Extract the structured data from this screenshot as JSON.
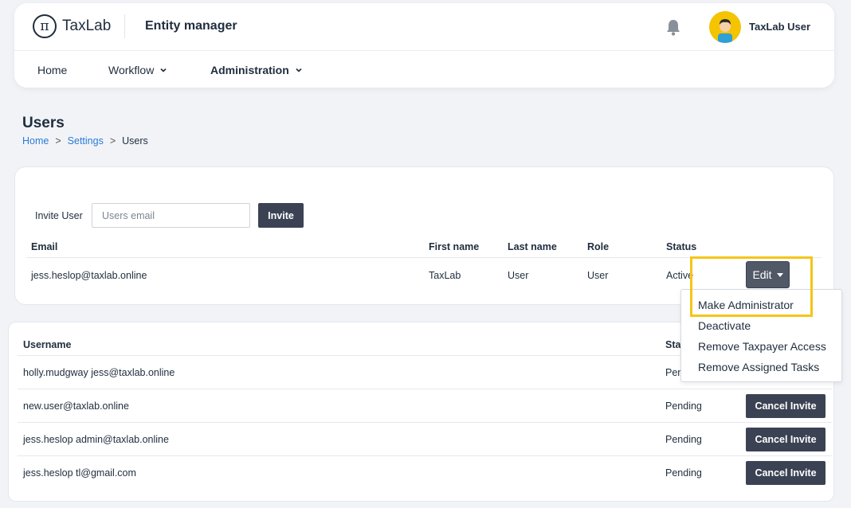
{
  "header": {
    "logo_symbol": "π",
    "logo_text": "TaxLab",
    "app_title": "Entity manager",
    "user_name": "TaxLab User",
    "nav": [
      {
        "label": "Home"
      },
      {
        "label": "Workflow"
      },
      {
        "label": "Administration"
      }
    ]
  },
  "page": {
    "title": "Users",
    "breadcrumb": [
      "Home",
      "Settings",
      "Users"
    ],
    "breadcrumb_sep": ">"
  },
  "invite": {
    "label": "Invite User",
    "placeholder": "Users email",
    "button": "Invite"
  },
  "users_table": {
    "headers": [
      "Email",
      "First name",
      "Last name",
      "Role",
      "Status"
    ],
    "rows": [
      {
        "email": "jess.heslop@taxlab.online",
        "first_name": "TaxLab",
        "last_name": "User",
        "role": "User",
        "status": "Active",
        "action": "Edit"
      }
    ]
  },
  "edit_menu": {
    "items": [
      "Make Administrator",
      "Deactivate",
      "Remove Taxpayer Access",
      "Remove Assigned Tasks"
    ]
  },
  "pending_table": {
    "headers": [
      "Username",
      "Sta"
    ],
    "rows": [
      {
        "username": "holly.mudgway jess@taxlab.online",
        "status": "Pen"
      },
      {
        "username": "new.user@taxlab.online",
        "status": "Pending",
        "action": "Cancel Invite"
      },
      {
        "username": "jess.heslop admin@taxlab.online",
        "status": "Pending",
        "action": "Cancel Invite"
      },
      {
        "username": "jess.heslop tl@gmail.com",
        "status": "Pending",
        "action": "Cancel Invite"
      }
    ]
  },
  "colors": {
    "highlight": "#f5c518",
    "button_dark": "#3b4253",
    "link": "#2b7bd6"
  }
}
